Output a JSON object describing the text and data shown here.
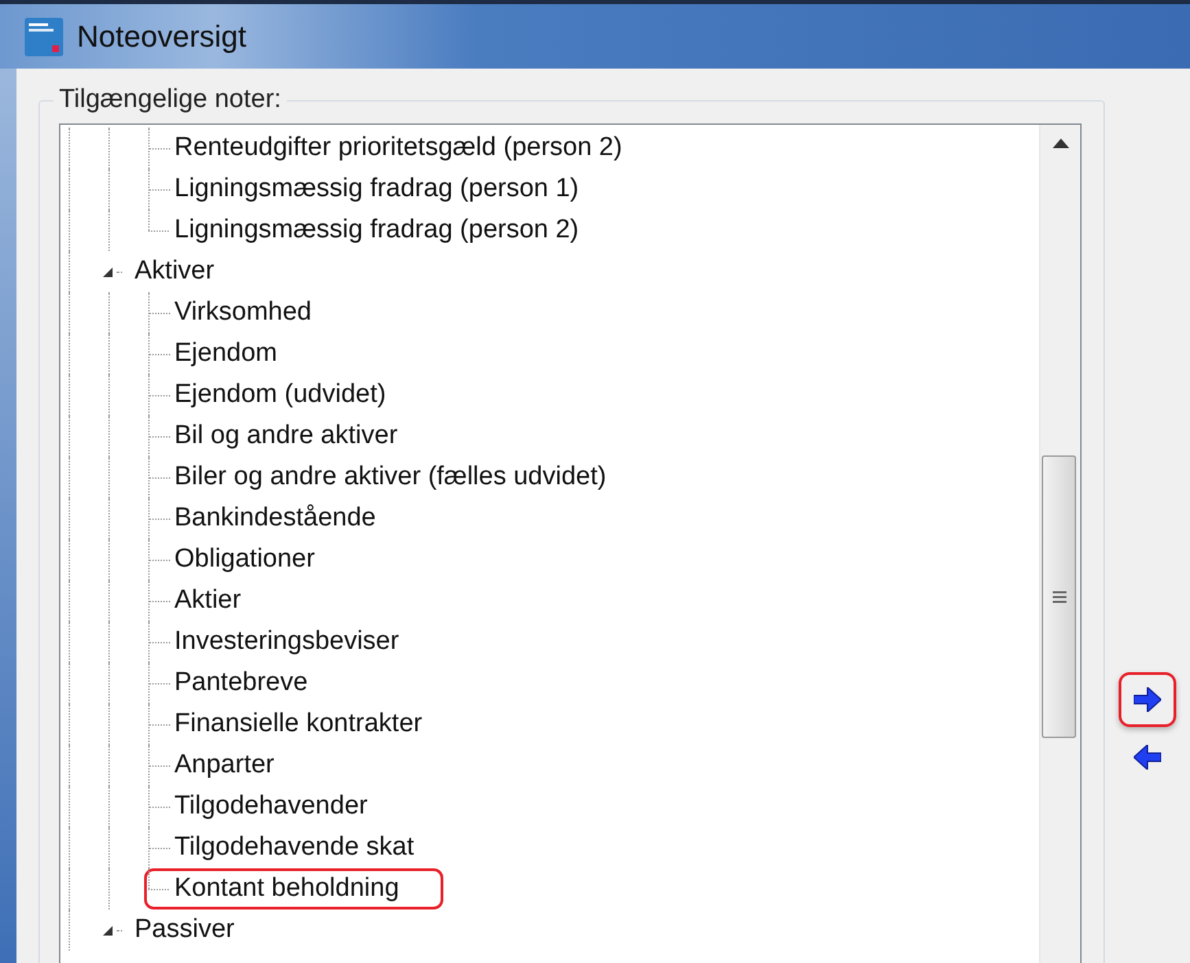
{
  "window": {
    "title": "Noteoversigt"
  },
  "group": {
    "label": "Tilgængelige noter:"
  },
  "tree": {
    "items": [
      {
        "children": [
          {
            "label": "Renteudgifter prioritetsgæld (person 2)",
            "annotated": false
          },
          {
            "label": "Ligningsmæssig fradrag (person 1)",
            "annotated": false
          },
          {
            "label": "Ligningsmæssig fradrag (person 2)",
            "annotated": false
          }
        ]
      },
      {
        "label": "Aktiver",
        "expanded": true,
        "annotated": false,
        "children": [
          {
            "label": "Virksomhed",
            "annotated": false
          },
          {
            "label": "Ejendom",
            "annotated": false
          },
          {
            "label": "Ejendom (udvidet)",
            "annotated": false
          },
          {
            "label": "Bil og andre aktiver",
            "annotated": false
          },
          {
            "label": "Biler og andre aktiver (fælles udvidet)",
            "annotated": false
          },
          {
            "label": "Bankindestående",
            "annotated": false
          },
          {
            "label": "Obligationer",
            "annotated": false
          },
          {
            "label": "Aktier",
            "annotated": false
          },
          {
            "label": "Investeringsbeviser",
            "annotated": false
          },
          {
            "label": "Pantebreve",
            "annotated": false
          },
          {
            "label": "Finansielle kontrakter",
            "annotated": false
          },
          {
            "label": "Anparter",
            "annotated": false
          },
          {
            "label": "Tilgodehavender",
            "annotated": false
          },
          {
            "label": "Tilgodehavende skat",
            "annotated": false
          },
          {
            "label": "Kontant beholdning",
            "annotated": true
          }
        ]
      },
      {
        "label": "Passiver",
        "expanded": true,
        "annotated": false
      }
    ]
  },
  "move_buttons": [
    {
      "kind": "add",
      "annotated": true
    },
    {
      "kind": "remove",
      "annotated": false
    }
  ]
}
